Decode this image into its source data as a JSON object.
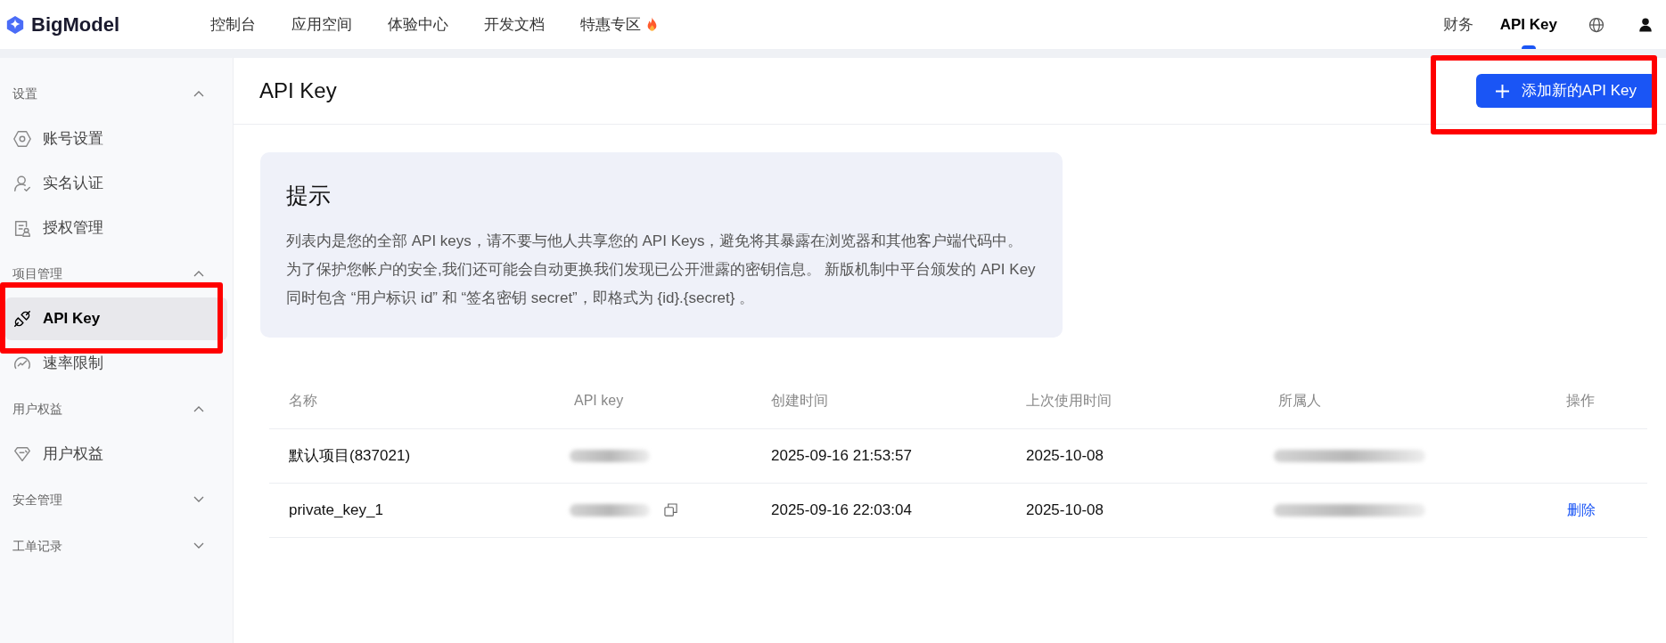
{
  "logo": {
    "text": "BigModel"
  },
  "top_nav": [
    {
      "label": "控制台",
      "selected": false,
      "kind": "plain"
    },
    {
      "label": "应用空间",
      "selected": false,
      "kind": "plain"
    },
    {
      "label": "体验中心",
      "selected": false,
      "kind": "plain"
    },
    {
      "label": "开发文档",
      "selected": false,
      "kind": "plain"
    },
    {
      "label": "特惠专区",
      "selected": false,
      "kind": "hot"
    }
  ],
  "top_right": [
    {
      "label": "财务",
      "selected": false
    },
    {
      "label": "API Key",
      "selected": true
    }
  ],
  "sidebar": [
    {
      "title": "设置",
      "expanded": true,
      "items": [
        {
          "label": "账号设置",
          "selected": false
        },
        {
          "label": "实名认证",
          "selected": false
        },
        {
          "label": "授权管理",
          "selected": false
        }
      ]
    },
    {
      "title": "项目管理",
      "expanded": true,
      "items": [
        {
          "label": "API Key",
          "selected": true
        },
        {
          "label": "速率限制",
          "selected": false
        }
      ]
    },
    {
      "title": "用户权益",
      "expanded": true,
      "items": [
        {
          "label": "用户权益",
          "selected": false
        }
      ]
    },
    {
      "title": "安全管理",
      "expanded": false
    },
    {
      "title": "工单记录",
      "expanded": false
    }
  ],
  "page_title": "API Key",
  "add_button": "添加新的API Key",
  "notice": {
    "title": "提示",
    "text": "列表内是您的全部 API keys，请不要与他人共享您的 API Keys，避免将其暴露在浏览器和其他客户端代码中。为了保护您帐户的安全,我们还可能会自动更换我们发现已公开泄露的密钥信息。 新版机制中平台颁发的 API Key 同时包含 “用户标识 id” 和 “签名密钥 secret”，即格式为 {id}.{secret} 。"
  },
  "table": {
    "columns": [
      "名称",
      "API key",
      "创建时间",
      "上次使用时间",
      "所属人",
      "操作"
    ],
    "rows": [
      {
        "name": "默认项目(837021)",
        "api_key_blurred": true,
        "copy_icon": false,
        "created": "2025-09-16 21:53:57",
        "last_used": "2025-10-08",
        "owner_blurred": true
      },
      {
        "name": "private_key_1",
        "api_key_blurred": true,
        "copy_icon": true,
        "created": "2025-09-16 22:03:04",
        "last_used": "2025-10-08",
        "owner_blurred": true,
        "action": "删除"
      }
    ]
  },
  "annotations": [
    {
      "kind": "highlight"
    },
    {
      "kind": "highlight"
    }
  ]
}
